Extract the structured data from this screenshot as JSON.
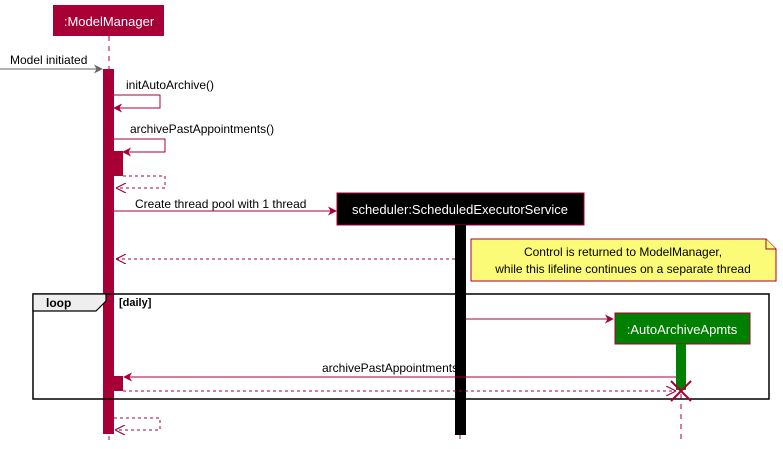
{
  "participants": {
    "model_manager": ":ModelManager",
    "scheduler": "scheduler:ScheduledExecutorService",
    "auto_archive": ":AutoArchiveApmts"
  },
  "messages": {
    "model_initiated": "Model initiated",
    "init_auto_archive": "initAutoArchive()",
    "archive_past_appointments": "archivePastAppointments()",
    "create_thread_pool": "Create thread pool with 1 thread",
    "archive_past_appointments_loop": "archivePastAppointments()"
  },
  "note": {
    "line1": "Control is returned to ModelManager,",
    "line2": "while this lifeline continues on a separate thread"
  },
  "loop": {
    "keyword": "loop",
    "guard": "[daily]"
  },
  "colors": {
    "model_manager": "#A80036",
    "scheduler_header": "#000000",
    "scheduler_border": "#A80036",
    "auto_archive": "#008000",
    "arrow": "#A80036",
    "note_fill": "#FBFB77",
    "note_border": "#A80036"
  }
}
